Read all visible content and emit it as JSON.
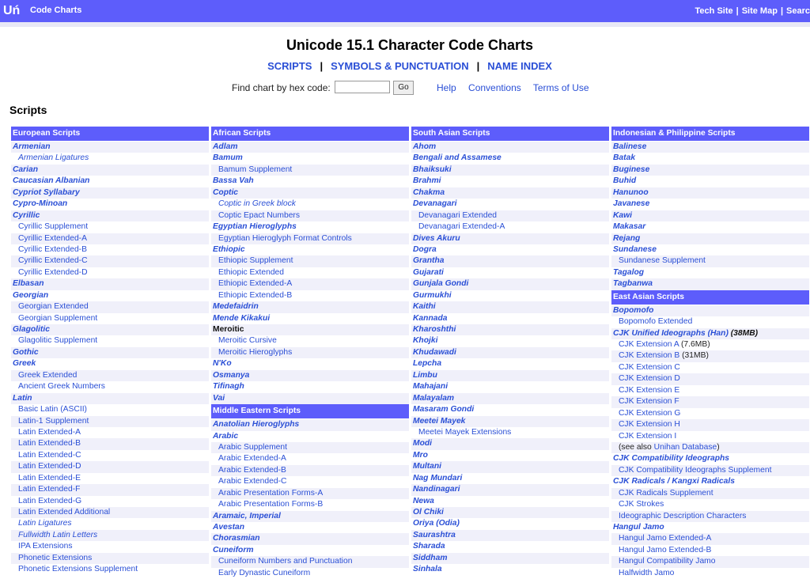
{
  "header": {
    "logo": "Uń",
    "brand": "Code Charts",
    "links": [
      "Tech Site",
      "Site Map",
      "Searc"
    ]
  },
  "title": "Unicode 15.1 Character Code Charts",
  "nav": [
    "SCRIPTS",
    "SYMBOLS & PUNCTUATION",
    "NAME INDEX"
  ],
  "find": {
    "label": "Find chart by hex code:",
    "value": "",
    "button": "Go"
  },
  "help_links": [
    "Help",
    "Conventions",
    "Terms of Use"
  ],
  "section_title": "Scripts",
  "columns": [
    {
      "groups": [
        {
          "heading": "European Scripts",
          "rows": [
            {
              "t": "Armenian",
              "k": "main"
            },
            {
              "t": "Armenian Ligatures",
              "k": "subital"
            },
            {
              "t": "Carian",
              "k": "main"
            },
            {
              "t": "Caucasian Albanian",
              "k": "main"
            },
            {
              "t": "Cypriot Syllabary",
              "k": "main"
            },
            {
              "t": "Cypro-Minoan",
              "k": "main"
            },
            {
              "t": "Cyrillic",
              "k": "main"
            },
            {
              "t": "Cyrillic Supplement",
              "k": "sub"
            },
            {
              "t": "Cyrillic Extended-A",
              "k": "sub"
            },
            {
              "t": "Cyrillic Extended-B",
              "k": "sub"
            },
            {
              "t": "Cyrillic Extended-C",
              "k": "sub"
            },
            {
              "t": "Cyrillic Extended-D",
              "k": "sub"
            },
            {
              "t": "Elbasan",
              "k": "main"
            },
            {
              "t": "Georgian",
              "k": "main"
            },
            {
              "t": "Georgian Extended",
              "k": "sub"
            },
            {
              "t": "Georgian Supplement",
              "k": "sub"
            },
            {
              "t": "Glagolitic",
              "k": "main"
            },
            {
              "t": "Glagolitic Supplement",
              "k": "sub"
            },
            {
              "t": "Gothic",
              "k": "main"
            },
            {
              "t": "Greek",
              "k": "main"
            },
            {
              "t": "Greek Extended",
              "k": "sub"
            },
            {
              "t": "Ancient Greek Numbers",
              "k": "sub"
            },
            {
              "t": "Latin",
              "k": "main"
            },
            {
              "t": "Basic Latin (ASCII)",
              "k": "sub"
            },
            {
              "t": "Latin-1 Supplement",
              "k": "sub"
            },
            {
              "t": "Latin Extended-A",
              "k": "sub"
            },
            {
              "t": "Latin Extended-B",
              "k": "sub"
            },
            {
              "t": "Latin Extended-C",
              "k": "sub"
            },
            {
              "t": "Latin Extended-D",
              "k": "sub"
            },
            {
              "t": "Latin Extended-E",
              "k": "sub"
            },
            {
              "t": "Latin Extended-F",
              "k": "sub"
            },
            {
              "t": "Latin Extended-G",
              "k": "sub"
            },
            {
              "t": "Latin Extended Additional",
              "k": "sub"
            },
            {
              "t": "Latin Ligatures",
              "k": "subital"
            },
            {
              "t": "Fullwidth Latin Letters",
              "k": "subital"
            },
            {
              "t": "IPA Extensions",
              "k": "sub"
            },
            {
              "t": "Phonetic Extensions",
              "k": "sub"
            },
            {
              "t": "Phonetic Extensions Supplement",
              "k": "sub"
            }
          ]
        }
      ]
    },
    {
      "groups": [
        {
          "heading": "African Scripts",
          "rows": [
            {
              "t": "Adlam",
              "k": "main"
            },
            {
              "t": "Bamum",
              "k": "main"
            },
            {
              "t": "Bamum Supplement",
              "k": "sub"
            },
            {
              "t": "Bassa Vah",
              "k": "main"
            },
            {
              "t": "Coptic",
              "k": "main"
            },
            {
              "t": "Coptic in Greek block",
              "k": "subital"
            },
            {
              "t": "Coptic Epact Numbers",
              "k": "sub"
            },
            {
              "t": "Egyptian Hieroglyphs",
              "k": "main"
            },
            {
              "t": "Egyptian Hieroglyph Format Controls",
              "k": "sub"
            },
            {
              "t": "Ethiopic",
              "k": "main"
            },
            {
              "t": "Ethiopic Supplement",
              "k": "sub"
            },
            {
              "t": "Ethiopic Extended",
              "k": "sub"
            },
            {
              "t": "Ethiopic Extended-A",
              "k": "sub"
            },
            {
              "t": "Ethiopic Extended-B",
              "k": "sub"
            },
            {
              "t": "Medefaidrin",
              "k": "main"
            },
            {
              "t": "Mende Kikakui",
              "k": "main"
            },
            {
              "t": "Meroitic",
              "k": "black"
            },
            {
              "t": "Meroitic Cursive",
              "k": "sub"
            },
            {
              "t": "Meroitic Hieroglyphs",
              "k": "sub"
            },
            {
              "t": "N'Ko",
              "k": "main"
            },
            {
              "t": "Osmanya",
              "k": "main"
            },
            {
              "t": "Tifinagh",
              "k": "main"
            },
            {
              "t": "Vai",
              "k": "main"
            }
          ]
        },
        {
          "heading": "Middle Eastern Scripts",
          "rows": [
            {
              "t": "Anatolian Hieroglyphs",
              "k": "main"
            },
            {
              "t": "Arabic",
              "k": "main"
            },
            {
              "t": "Arabic Supplement",
              "k": "sub"
            },
            {
              "t": "Arabic Extended-A",
              "k": "sub"
            },
            {
              "t": "Arabic Extended-B",
              "k": "sub"
            },
            {
              "t": "Arabic Extended-C",
              "k": "sub"
            },
            {
              "t": "Arabic Presentation Forms-A",
              "k": "sub"
            },
            {
              "t": "Arabic Presentation Forms-B",
              "k": "sub"
            },
            {
              "t": "Aramaic, Imperial",
              "k": "main"
            },
            {
              "t": "Avestan",
              "k": "main"
            },
            {
              "t": "Chorasmian",
              "k": "main"
            },
            {
              "t": "Cuneiform",
              "k": "main"
            },
            {
              "t": "Cuneiform Numbers and Punctuation",
              "k": "sub"
            },
            {
              "t": "Early Dynastic Cuneiform",
              "k": "sub"
            }
          ]
        }
      ]
    },
    {
      "groups": [
        {
          "heading": "South Asian Scripts",
          "rows": [
            {
              "t": "Ahom",
              "k": "main"
            },
            {
              "t": "Bengali and Assamese",
              "k": "main"
            },
            {
              "t": "Bhaiksuki",
              "k": "main"
            },
            {
              "t": "Brahmi",
              "k": "main"
            },
            {
              "t": "Chakma",
              "k": "main"
            },
            {
              "t": "Devanagari",
              "k": "main"
            },
            {
              "t": "Devanagari Extended",
              "k": "sub"
            },
            {
              "t": "Devanagari Extended-A",
              "k": "sub"
            },
            {
              "t": "Dives Akuru",
              "k": "main"
            },
            {
              "t": "Dogra",
              "k": "main"
            },
            {
              "t": "Grantha",
              "k": "main"
            },
            {
              "t": "Gujarati",
              "k": "main"
            },
            {
              "t": "Gunjala Gondi",
              "k": "main"
            },
            {
              "t": "Gurmukhi",
              "k": "main"
            },
            {
              "t": "Kaithi",
              "k": "main"
            },
            {
              "t": "Kannada",
              "k": "main"
            },
            {
              "t": "Kharoshthi",
              "k": "main"
            },
            {
              "t": "Khojki",
              "k": "main"
            },
            {
              "t": "Khudawadi",
              "k": "main"
            },
            {
              "t": "Lepcha",
              "k": "main"
            },
            {
              "t": "Limbu",
              "k": "main"
            },
            {
              "t": "Mahajani",
              "k": "main"
            },
            {
              "t": "Malayalam",
              "k": "main"
            },
            {
              "t": "Masaram Gondi",
              "k": "main"
            },
            {
              "t": "Meetei Mayek",
              "k": "main"
            },
            {
              "t": "Meetei Mayek Extensions",
              "k": "sub"
            },
            {
              "t": "Modi",
              "k": "main"
            },
            {
              "t": "Mro",
              "k": "main"
            },
            {
              "t": "Multani",
              "k": "main"
            },
            {
              "t": "Nag Mundari",
              "k": "main"
            },
            {
              "t": "Nandinagari",
              "k": "main"
            },
            {
              "t": "Newa",
              "k": "main"
            },
            {
              "t": "Ol Chiki",
              "k": "main"
            },
            {
              "t": "Oriya (Odia)",
              "k": "main"
            },
            {
              "t": "Saurashtra",
              "k": "main"
            },
            {
              "t": "Sharada",
              "k": "main"
            },
            {
              "t": "Siddham",
              "k": "main"
            },
            {
              "t": "Sinhala",
              "k": "main"
            }
          ]
        }
      ]
    },
    {
      "groups": [
        {
          "heading": "Indonesian & Philippine Scripts",
          "rows": [
            {
              "t": "Balinese",
              "k": "main"
            },
            {
              "t": "Batak",
              "k": "main"
            },
            {
              "t": "Buginese",
              "k": "main"
            },
            {
              "t": "Buhid",
              "k": "main"
            },
            {
              "t": "Hanunoo",
              "k": "main"
            },
            {
              "t": "Javanese",
              "k": "main"
            },
            {
              "t": "Kawi",
              "k": "main"
            },
            {
              "t": "Makasar",
              "k": "main"
            },
            {
              "t": "Rejang",
              "k": "main"
            },
            {
              "t": "Sundanese",
              "k": "main"
            },
            {
              "t": "Sundanese Supplement",
              "k": "sub"
            },
            {
              "t": "Tagalog",
              "k": "main"
            },
            {
              "t": "Tagbanwa",
              "k": "main"
            }
          ]
        },
        {
          "heading": "East Asian Scripts",
          "rows": [
            {
              "t": "Bopomofo",
              "k": "main"
            },
            {
              "t": "Bopomofo Extended",
              "k": "sub"
            },
            {
              "t": "CJK Unified Ideographs (Han)",
              "k": "main",
              "m": "(38MB)",
              "mk": "strong"
            },
            {
              "t": "CJK Extension A",
              "k": "sub",
              "m": "(7.6MB)"
            },
            {
              "t": "CJK Extension B",
              "k": "sub",
              "m": "(31MB)"
            },
            {
              "t": "CJK Extension C",
              "k": "sub"
            },
            {
              "t": "CJK Extension D",
              "k": "sub"
            },
            {
              "t": "CJK Extension E",
              "k": "sub"
            },
            {
              "t": "CJK Extension F",
              "k": "sub"
            },
            {
              "t": "CJK Extension G",
              "k": "sub"
            },
            {
              "t": "CJK Extension H",
              "k": "sub"
            },
            {
              "t": "CJK Extension I",
              "k": "sub"
            },
            {
              "t": "Unihan Database",
              "k": "sub",
              "pre": "(see also ",
              "m": ")"
            },
            {
              "t": "CJK Compatibility Ideographs",
              "k": "main"
            },
            {
              "t": "CJK Compatibility Ideographs Supplement",
              "k": "sub"
            },
            {
              "t": "CJK Radicals / Kangxi Radicals",
              "k": "main"
            },
            {
              "t": "CJK Radicals Supplement",
              "k": "sub"
            },
            {
              "t": "CJK Strokes",
              "k": "sub"
            },
            {
              "t": "Ideographic Description Characters",
              "k": "sub"
            },
            {
              "t": "Hangul Jamo",
              "k": "main"
            },
            {
              "t": "Hangul Jamo Extended-A",
              "k": "sub"
            },
            {
              "t": "Hangul Jamo Extended-B",
              "k": "sub"
            },
            {
              "t": "Hangul Compatibility Jamo",
              "k": "sub"
            },
            {
              "t": "Halfwidth Jamo",
              "k": "sub"
            }
          ]
        }
      ]
    }
  ],
  "colors": {
    "accent": "#5d5dfb",
    "link": "#2a4fd6",
    "alt_row": "#f0f0fa"
  }
}
